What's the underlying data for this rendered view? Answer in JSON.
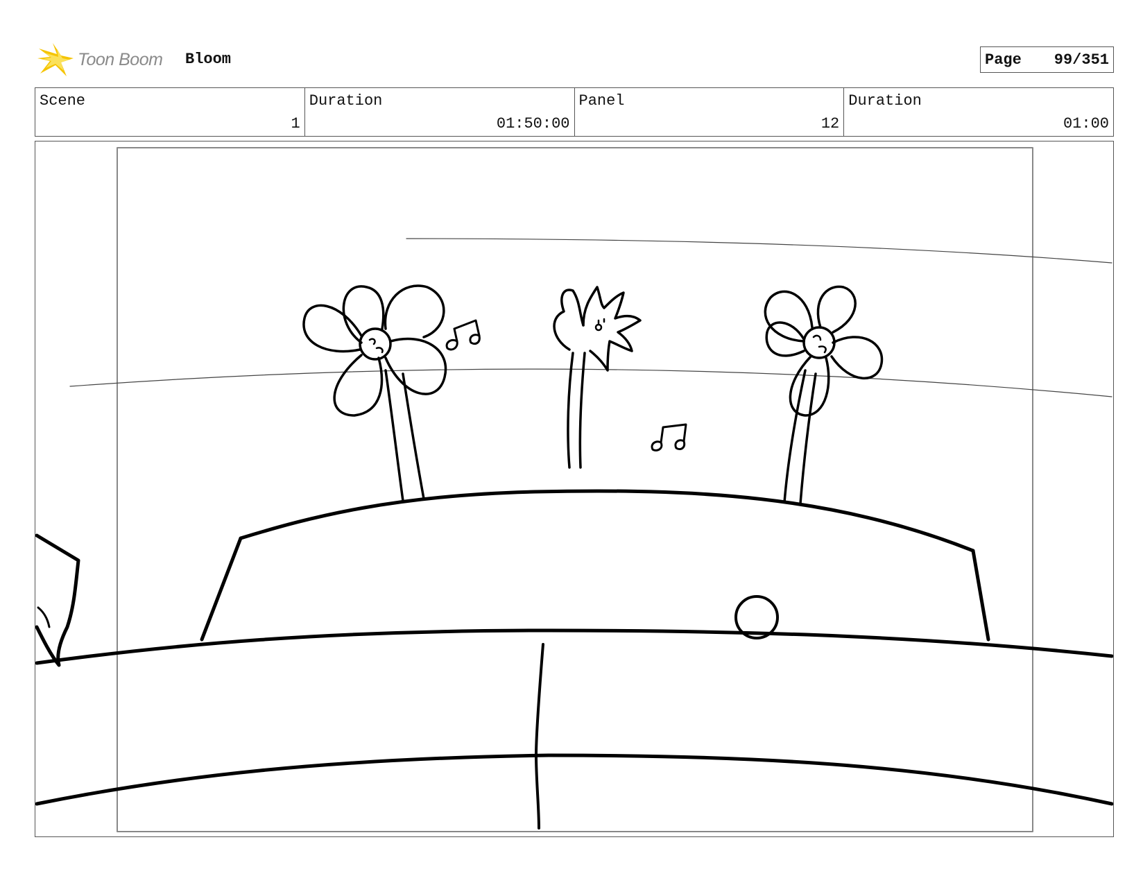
{
  "header": {
    "logo_text": "Toon Boom",
    "project_title": "Bloom",
    "page_label": "Page",
    "page_value": "99/351"
  },
  "info": {
    "scene_label": "Scene",
    "scene_value": "1",
    "scene_duration_label": "Duration",
    "scene_duration_value": "01:50:00",
    "panel_label": "Panel",
    "panel_value": "12",
    "panel_duration_label": "Duration",
    "panel_duration_value": "01:00"
  },
  "colors": {
    "logo_star": "#f5c400",
    "logo_text": "#8a8a8a",
    "border": "#555555",
    "sketch": "#000000"
  },
  "icons": [
    "toon-boom-star-icon"
  ]
}
